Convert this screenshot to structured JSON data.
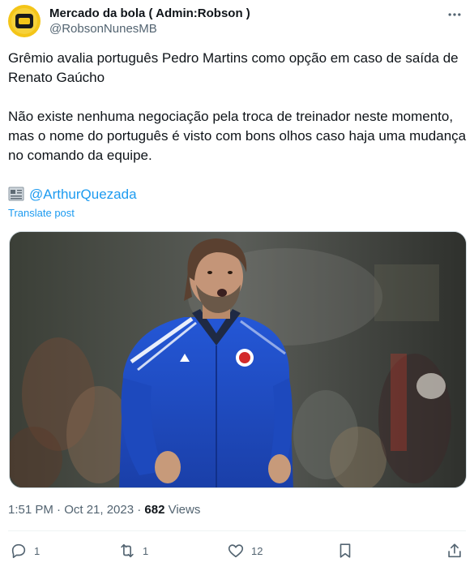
{
  "author": {
    "display_name": "Mercado da bola ( Admin:Robson )",
    "handle": "@RobsonNunesMB"
  },
  "tweet": {
    "paragraph1": "Grêmio avalia português Pedro Martins como opção em caso de saída de Renato Gaúcho",
    "paragraph2": "Não existe nenhuma negociação pela troca de treinador neste momento, mas o nome do português é visto com bons olhos caso haja uma mudança no comando da equipe.",
    "mention": "@ArthurQuezada",
    "translate_label": "Translate post"
  },
  "meta": {
    "timestamp": "1:51 PM · Oct 21, 2023 · ",
    "views_count": "682",
    "views_label": " Views"
  },
  "actions": {
    "replies": "1",
    "reposts": "1",
    "likes": "12"
  },
  "colors": {
    "link": "#1d9bf0",
    "secondary_text": "#536471",
    "jacket": "#1e4fc9"
  }
}
